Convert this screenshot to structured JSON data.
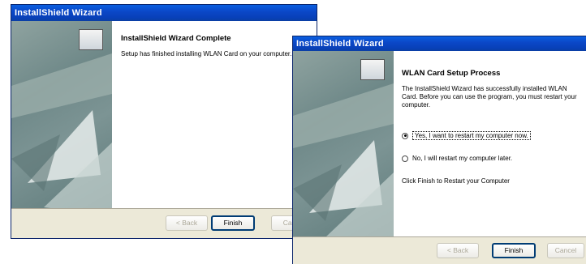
{
  "dialog_back": {
    "title": "InstallShield Wizard",
    "heading": "InstallShield Wizard Complete",
    "message": "Setup has finished installing WLAN Card on your computer.",
    "buttons": {
      "back": "< Back",
      "finish": "Finish",
      "cancel": "Cancel"
    }
  },
  "dialog_front": {
    "title": "InstallShield Wizard",
    "heading": "WLAN Card Setup Process",
    "message": "The InstallShield Wizard has successfully installed WLAN Card.  Before you can use the program, you must restart your computer.",
    "options": [
      {
        "label": "Yes, I want to restart my computer now.",
        "selected": true
      },
      {
        "label": "No, I will restart my computer later.",
        "selected": false
      }
    ],
    "instruction": "Click Finish to Restart your Computer",
    "buttons": {
      "back": "< Back",
      "finish": "Finish",
      "cancel": "Cancel"
    }
  }
}
